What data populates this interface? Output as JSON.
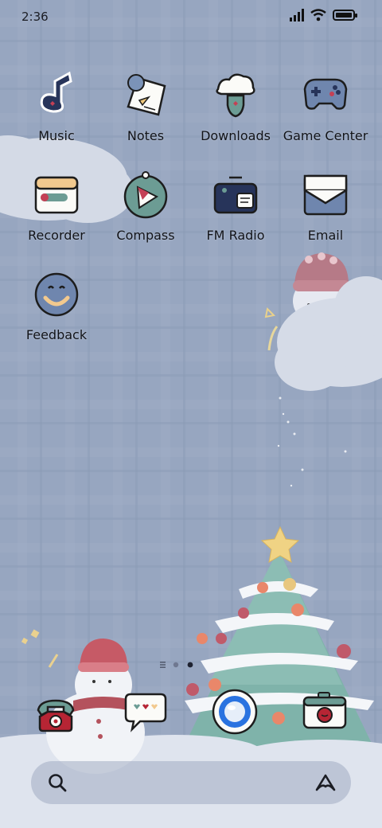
{
  "status_bar": {
    "time": "2:36",
    "icons": [
      "signal-icon",
      "wifi-icon",
      "battery-icon"
    ]
  },
  "apps": [
    {
      "label": "Music",
      "icon": "music-note-icon"
    },
    {
      "label": "Notes",
      "icon": "notes-icon"
    },
    {
      "label": "Downloads",
      "icon": "downloads-icon"
    },
    {
      "label": "Game Center",
      "icon": "gamepad-icon"
    },
    {
      "label": "Recorder",
      "icon": "recorder-icon"
    },
    {
      "label": "Compass",
      "icon": "compass-icon"
    },
    {
      "label": "FM Radio",
      "icon": "radio-icon"
    },
    {
      "label": "Email",
      "icon": "envelope-icon"
    },
    {
      "label": "Feedback",
      "icon": "smiley-icon"
    }
  ],
  "page_indicator": {
    "pages": 2,
    "current": 2
  },
  "dock": [
    {
      "icon": "phone-icon"
    },
    {
      "icon": "messages-icon"
    },
    {
      "icon": "browser-icon"
    },
    {
      "icon": "camera-icon"
    }
  ],
  "search_bar": {
    "icons": [
      "search-icon",
      "assistant-icon"
    ]
  },
  "colors": {
    "background": "#97a6c0",
    "icon_navy": "#27345a",
    "icon_teal": "#6c9c94",
    "icon_red": "#b62534",
    "tree_green": "#7fb3aa"
  }
}
